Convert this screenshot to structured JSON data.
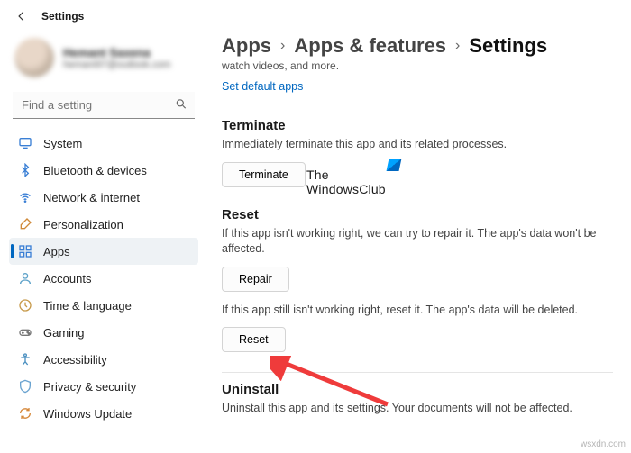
{
  "topbar": {
    "title": "Settings"
  },
  "user": {
    "name": "Hemant Saxena",
    "email": "hemant97@outlook.com"
  },
  "search": {
    "placeholder": "Find a setting"
  },
  "sidebar": {
    "items": [
      {
        "label": "System"
      },
      {
        "label": "Bluetooth & devices"
      },
      {
        "label": "Network & internet"
      },
      {
        "label": "Personalization"
      },
      {
        "label": "Apps"
      },
      {
        "label": "Accounts"
      },
      {
        "label": "Time & language"
      },
      {
        "label": "Gaming"
      },
      {
        "label": "Accessibility"
      },
      {
        "label": "Privacy & security"
      },
      {
        "label": "Windows Update"
      }
    ]
  },
  "breadcrumb": {
    "a": "Apps",
    "b": "Apps & features",
    "c": "Settings"
  },
  "main": {
    "intro_tail": "watch videos, and more.",
    "default_apps_link": "Set default apps",
    "terminate": {
      "title": "Terminate",
      "desc": "Immediately terminate this app and its related processes.",
      "btn": "Terminate"
    },
    "reset": {
      "title": "Reset",
      "desc1": "If this app isn't working right, we can try to repair it. The app's data won't be affected.",
      "repair_btn": "Repair",
      "desc2": "If this app still isn't working right, reset it. The app's data will be deleted.",
      "reset_btn": "Reset"
    },
    "uninstall": {
      "title": "Uninstall",
      "desc": "Uninstall this app and its settings. Your documents will not be affected."
    }
  },
  "watermark": {
    "line1": "The",
    "line2": "WindowsClub",
    "source": "wsxdn.com"
  }
}
